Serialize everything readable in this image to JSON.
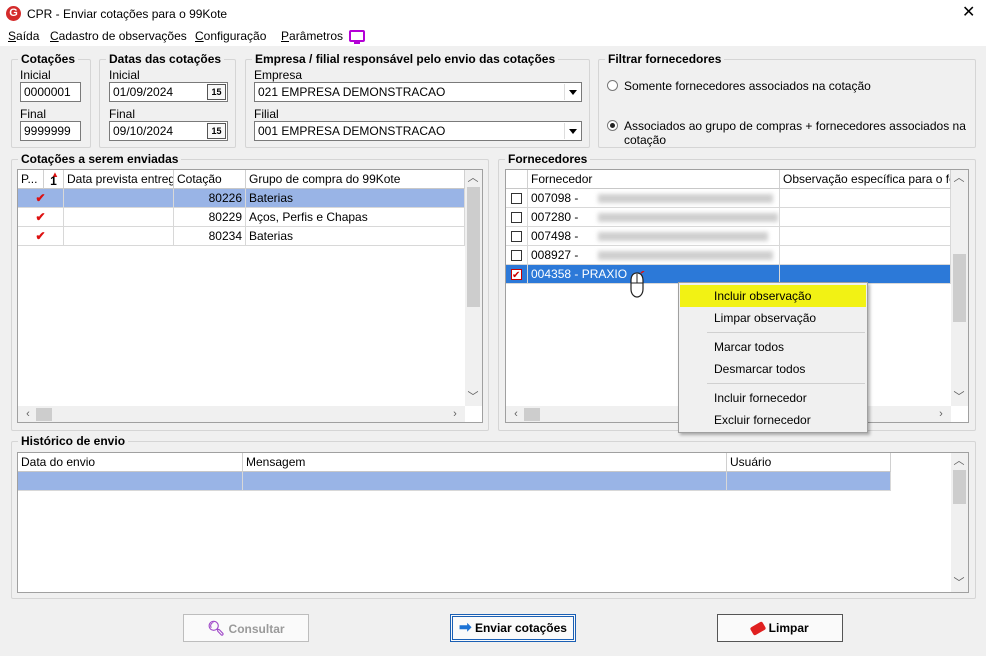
{
  "window": {
    "title": "CPR - Enviar cotações para o 99Kote",
    "logo": "G"
  },
  "menu": [
    "Saída",
    "Cadastro de observações",
    "Configuração",
    "Parâmetros"
  ],
  "cotacoes": {
    "title": "Cotações",
    "inicial_label": "Inicial",
    "inicial_value": "0000001",
    "final_label": "Final",
    "final_value": "9999999"
  },
  "datas": {
    "title": "Datas das cotações",
    "inicial_label": "Inicial",
    "inicial_value": "01/09/2024",
    "final_label": "Final",
    "final_value": "09/10/2024",
    "cal_icon": "15"
  },
  "empresa": {
    "title": "Empresa / filial responsável pelo envio das cotações",
    "empresa_label": "Empresa",
    "empresa_value": "021 EMPRESA DEMONSTRACAO",
    "filial_label": "Filial",
    "filial_value": "001 EMPRESA DEMONSTRACAO"
  },
  "filtro": {
    "title": "Filtrar fornecedores",
    "opt1": "Somente fornecedores associados na cotação",
    "opt2": "Associados ao grupo de compras + fornecedores associados na cotação",
    "selected": 2
  },
  "cotacoes_grid": {
    "title": "Cotações a serem enviadas",
    "headers": [
      "P...",
      "1",
      "Data prevista entrega",
      "Cotação",
      "Grupo de compra do 99Kote"
    ],
    "rows": [
      {
        "checked": "✔",
        "data": "",
        "cotacao": "80226",
        "grupo": "Baterias"
      },
      {
        "checked": "✔",
        "data": "",
        "cotacao": "80229",
        "grupo": "Aços, Perfis e Chapas"
      },
      {
        "checked": "✔",
        "data": "",
        "cotacao": "80234",
        "grupo": "Baterias"
      }
    ]
  },
  "fornecedores": {
    "title": "Fornecedores",
    "headers": [
      "Fornecedor",
      "Observação específica para o forne"
    ],
    "rows": [
      {
        "code": "007098 -",
        "name": "",
        "checked": false
      },
      {
        "code": "007280 -",
        "name": "",
        "checked": false
      },
      {
        "code": "007498 -",
        "name": "",
        "checked": false
      },
      {
        "code": "008927 -",
        "name": "",
        "checked": false
      },
      {
        "code": "004358 -",
        "name": "PRAXIO",
        "checked": true
      }
    ]
  },
  "context_menu": [
    "Incluir observação",
    "Limpar observação",
    "Marcar todos",
    "Desmarcar todos",
    "Incluir fornecedor",
    "Excluir fornecedor"
  ],
  "historico": {
    "title": "Histórico de envio",
    "headers": [
      "Data do envio",
      "Mensagem",
      "Usuário"
    ]
  },
  "buttons": {
    "consultar": "Consultar",
    "enviar": "Enviar cotações",
    "limpar": "Limpar"
  }
}
